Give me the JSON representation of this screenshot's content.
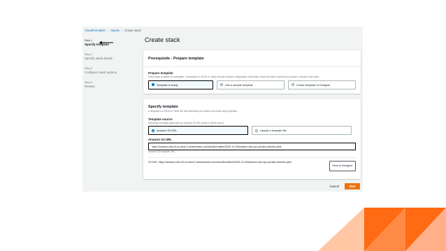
{
  "breadcrumb": {
    "item1": "CloudFormation",
    "item2": "Stacks",
    "item3": "Create stack",
    "separator": "›"
  },
  "steps": [
    {
      "num": "Step 1",
      "title": "Specify template"
    },
    {
      "num": "Step 2",
      "title": "Specify stack details"
    },
    {
      "num": "Step 3",
      "title": "Configure stack options"
    },
    {
      "num": "Step 4",
      "title": "Review"
    }
  ],
  "page_title": "Create stack",
  "prereq": {
    "header": "Prerequisite - Prepare template",
    "label": "Prepare template",
    "description": "Every stack is based on a template. A template is a JSON or YAML file that contains configuration information about the AWS resources you want to include in the stack.",
    "options": [
      "Template is ready",
      "Use a sample template",
      "Create template in Designer"
    ]
  },
  "specify": {
    "header": "Specify template",
    "description": "A template is a JSON or YAML file that describes your stack's resources and properties.",
    "source_label": "Template source",
    "source_description": "Selecting a template generates an Amazon S3 URL where it will be stored.",
    "source_options": [
      "Amazon S3 URL",
      "Upload a template file"
    ],
    "url_label": "Amazon S3 URL",
    "url_value": "https://amazon-eks.s3.us-west-2.amazonaws.com/cloudformation/2020-10-29/amazon-eks-vpc-private-subnets.yaml",
    "url_hint": "Amazon S3 template URL",
    "s3_url_text": "S3 URL:  https://amazon-eks.s3.us-west-2.amazonaws.com/cloudformation/2020-10-29/amazon-eks-vpc-private-subnets.yaml",
    "view_designer": "View in Designer"
  },
  "footer": {
    "cancel": "Cancel",
    "next": "Next"
  },
  "colors": {
    "accent_orange": "#ec7211",
    "link_blue": "#0073bb",
    "deco_orange": "#ff6a13",
    "deco_peach": "#ffc7a3"
  }
}
